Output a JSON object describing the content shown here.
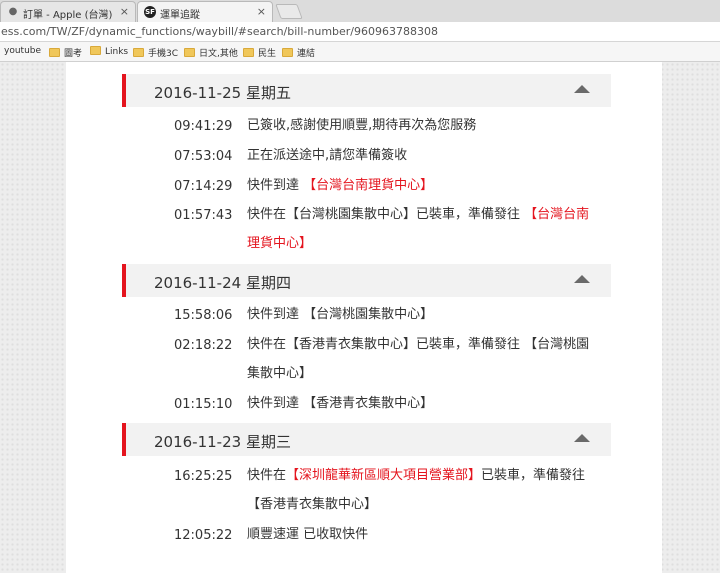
{
  "browser": {
    "tabs": [
      {
        "title": "訂單 - Apple (台灣)",
        "icon": "apple-icon",
        "active": false
      },
      {
        "title": "運單追蹤",
        "icon": "sf-logo-icon",
        "active": true
      }
    ],
    "close_glyph": "×",
    "url": "ess.com/TW/ZF/dynamic_functions/waybill/#search/bill-number/960963788308",
    "bookmarks": [
      "youtube",
      "圖考",
      "Links",
      "手機3C",
      "日文,其他",
      "民生",
      "連結"
    ]
  },
  "waybill": {
    "days": [
      {
        "date": "2016-11-25 星期五",
        "events": [
          {
            "time": "09:41:29",
            "parts": [
              {
                "t": "已簽收,感謝使用順豐,期待再次為您服務",
                "red": false
              }
            ]
          },
          {
            "time": "07:53:04",
            "parts": [
              {
                "t": "正在派送途中,請您準備簽收",
                "red": false
              }
            ]
          },
          {
            "time": "07:14:29",
            "parts": [
              {
                "t": "快件到達 ",
                "red": false
              },
              {
                "t": "【台灣台南理貨中心】",
                "red": true
              }
            ]
          },
          {
            "time": "01:57:43",
            "parts": [
              {
                "t": "快件在【台灣桃園集散中心】已裝車，準備發往 ",
                "red": false
              },
              {
                "t": "【台灣台南理貨中心】",
                "red": true
              }
            ]
          }
        ]
      },
      {
        "date": "2016-11-24 星期四",
        "events": [
          {
            "time": "15:58:06",
            "parts": [
              {
                "t": "快件到達 【台灣桃園集散中心】",
                "red": false
              }
            ]
          },
          {
            "time": "02:18:22",
            "parts": [
              {
                "t": "快件在【香港青衣集散中心】已裝車，準備發往 【台灣桃園集散中心】",
                "red": false
              }
            ]
          },
          {
            "time": "01:15:10",
            "parts": [
              {
                "t": "快件到達 【香港青衣集散中心】",
                "red": false
              }
            ]
          }
        ]
      },
      {
        "date": "2016-11-23 星期三",
        "events": [
          {
            "time": "16:25:25",
            "parts": [
              {
                "t": "快件在",
                "red": false
              },
              {
                "t": "【深圳龍華新區順大項目營業部】",
                "red": true
              },
              {
                "t": "已裝車，準備發往 【香港青衣集散中心】",
                "red": false
              }
            ]
          },
          {
            "time": "12:05:22",
            "parts": [
              {
                "t": "順豐速運 已收取快件",
                "red": false
              }
            ]
          }
        ]
      }
    ]
  }
}
